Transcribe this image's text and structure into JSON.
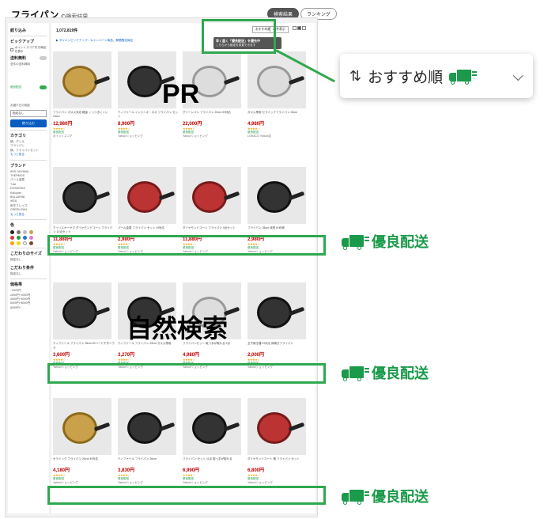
{
  "header": {
    "title": "フライパン",
    "title_suffix": "の検索結果",
    "tabs": [
      "検索結果",
      "ランキング"
    ]
  },
  "sidebar": {
    "heading": "絞り込み",
    "pickup_label": "ピックアップ",
    "pickup_item": "ポイントスコア付き商品を表示",
    "free_shipping": "送料無料",
    "free_shipping_note": "全件の送料無料",
    "excellent_shipping": "優良配送",
    "delivery_date_label": "お届け日の指定",
    "delivery_date_value": "指定なし",
    "filter_button": "絞り込む",
    "category_heading": "カテゴリ",
    "categories": [
      "鍋、グリル",
      "フライパン",
      "鍋、フライパンセット"
    ],
    "more_label": "もっと見る",
    "brand_heading": "ブランド",
    "brands": [
      "IRIS OHYAMA",
      "THERMOS",
      "パール金属",
      "T-fal",
      "DOSHISHA",
      "Kalcuyer",
      "BALLARINI",
      "IKEA",
      "和平フレイズ",
      "GREEN PAN"
    ],
    "color_heading": "色",
    "size_heading": "こだわりのサイズ",
    "size_value": "指定なし",
    "condition_heading": "こだわり条件",
    "condition_value": "指定なし",
    "price_heading": "価格帯",
    "price_ranges": [
      "~2000円",
      "2000円~4000円",
      "4000円~6000円",
      "6000円~8000円",
      "8000円~"
    ]
  },
  "toolbar": {
    "result_count": "1,072,819件",
    "banner_text": "▶ ダイエンピックアップ：キャンペーン商品、期間限定商品",
    "sort_label_mini": "おすすめ順",
    "per_page_mini": "45件表示",
    "tooltip_title": "早く届く「優良配送」を優先中",
    "tooltip_body": "こちらから設定を変更できます"
  },
  "products": [
    {
      "name": "フライパン ガス火対応 軽量 くっつきにくい 24cm",
      "price": "12,980円",
      "shop": "ポイントスコア",
      "color": "gold"
    },
    {
      "name": "ティファール インジニオ・ネオ フライパン セット",
      "price": "8,900円",
      "shop": "Yahoo!ショッピング",
      "color": "dark"
    },
    {
      "name": "グリーンパン フライパン 20cm IH対応",
      "price": "22,000円",
      "shop": "Yahoo!ショッピング",
      "color": "white"
    },
    {
      "name": "ガス火専用 セラミックフライパン 26cm",
      "price": "4,980円",
      "shop": "LOHACO Yahoo!店",
      "color": "white"
    },
    {
      "name": "アイリスオーヤマ ダイヤモンドコート フライパン 10点セット",
      "price": "11,880円",
      "shop": "Yahoo!ショッピング",
      "color": "dark"
    },
    {
      "name": "パール金属 フライパン セット IH対応",
      "price": "2,980円",
      "shop": "Yahoo!ショッピング",
      "color": "red"
    },
    {
      "name": "ダイヤモンドコート フライパン 9点セット",
      "price": "11,880円",
      "shop": "Yahoo!ショッピング",
      "color": "red"
    },
    {
      "name": "フライパン 28cm 深型 炒め鍋",
      "price": "2,980円",
      "shop": "Yahoo!ショッピング",
      "color": "dark"
    },
    {
      "name": "ティファール フライパン 26cm IHハードチタニウム",
      "price": "3,600円",
      "shop": "Yahoo!ショッピング",
      "color": "dark"
    },
    {
      "name": "ティファール フライパン 24cm ガス火専用",
      "price": "3,270円",
      "shop": "Yahoo!ショッピング",
      "color": "dark"
    },
    {
      "name": "フライパンセット 取っ手が取れる 9点",
      "price": "4,980円",
      "shop": "Yahoo!ショッピング",
      "color": "white"
    },
    {
      "name": "玉子焼き器 IH対応 卵焼きフライパン",
      "price": "2,000円",
      "shop": "Yahoo!ショッピング",
      "color": "dark"
    },
    {
      "name": "セラミック フライパン 26cm IH対応",
      "price": "4,180円",
      "shop": "Yahoo!ショッピング",
      "color": "gold"
    },
    {
      "name": "ティファール フライパン 26cm",
      "price": "3,830円",
      "shop": "Yahoo!ショッピング",
      "color": "dark"
    },
    {
      "name": "フライパン セット 11点 取っ手が取れる",
      "price": "6,990円",
      "shop": "Yahoo!ショッピング",
      "color": "dark"
    },
    {
      "name": "ダイヤモンドコート 鍋 フライパン セット",
      "price": "6,800円",
      "shop": "Yahoo!ショッピング",
      "color": "red"
    }
  ],
  "annotations": {
    "pr_label": "PR",
    "organic_label": "自然検索",
    "sort_callout_label": "おすすめ順",
    "badge_label": "優良配送",
    "highlight_color": "#2fa84f",
    "badge_color": "#1a9a4a"
  }
}
